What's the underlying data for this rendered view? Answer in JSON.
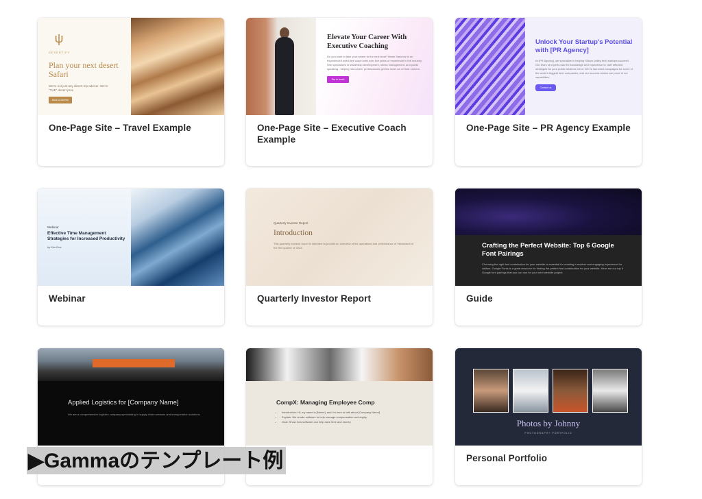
{
  "cards": [
    {
      "title": "One-Page Site – Travel Example",
      "thumb": {
        "brand": "DESERTIFY",
        "headline": "Plan your next desert Safari",
        "sub": "We're not just any desert trip adviser. We're \"THE\" desert pros",
        "button": "Book a Journey"
      }
    },
    {
      "title": "One-Page Site – Executive Coach Example",
      "thumb": {
        "headline": "Elevate Your Career With Executive Coaching",
        "sub": "Do you want to take your career to the next level? Marie Sanchez is an experienced executive coach with over five years of experience in the industry. She specializes in leadership development, stress management, and public speaking - helping mid-career professionals get the most out of their careers.",
        "button": "Get in touch"
      }
    },
    {
      "title": "One-Page Site – PR Agency Example",
      "thumb": {
        "headline": "Unlock Your Startup's Potential with [PR Agency]",
        "sub": "At [PR Agency], we specialize in helping Silicon Valley tech startups succeed. Our team of experts has the knowledge and experience to craft effective strategies for your public relations need. We've launched campaigns for some of the world's biggest tech companies, and our success stories are proof of our capabilities.",
        "button": "Contact us"
      }
    },
    {
      "title": "Webinar",
      "thumb": {
        "kicker": "Webinar",
        "headline": "Effective Time Management Strategies for Increased Productivity",
        "by": "by Kim Doe"
      }
    },
    {
      "title": "Quarterly Investor Report",
      "thumb": {
        "kicker": "Quarterly Investor Report",
        "headline": "Introduction",
        "sub": "This quarterly investor report is intended to provide an overview of the operations and performance of Ventanisch in the first quarter of 2023."
      }
    },
    {
      "title": "Guide",
      "thumb": {
        "headline": "Crafting the Perfect Website: Top 6 Google Font Pairings",
        "sub": "Choosing the right font combination for your website is essential for creating a modern and engaging experience for visitors. Google Fonts is a great resource for finding the perfect font combination for your website. Here are our top 6 Google font pairings that you can use for your next website project."
      }
    },
    {
      "title": "",
      "thumb": {
        "headline": "Applied Logistics for [Company Name]",
        "sub": "We are a comprehensive logistics company specializing in supply chain services and transportation solutions."
      }
    },
    {
      "title": "",
      "thumb": {
        "headline": "CompX: Managing Employee Comp",
        "bullets": [
          "Introduction: Hi, my name is [Name], and I'm here to talk about [Company Name]",
          "Explain: We create software to help manage compensation and equity",
          "Goal: Show how software can help save time and money"
        ]
      }
    },
    {
      "title": "Personal Portfolio",
      "thumb": {
        "headline": "Photos by Johnny",
        "sub": "PHOTOGRAPHY PORTFOLIO"
      }
    }
  ],
  "overlay": {
    "banner_text": "▶Gammaのテンプレート例"
  },
  "colors": {
    "travel_accent": "#b98a4a",
    "coach_button": "#c034d6",
    "pr_accent": "#5a4de6",
    "portfolio_title": "#c6bff0"
  }
}
